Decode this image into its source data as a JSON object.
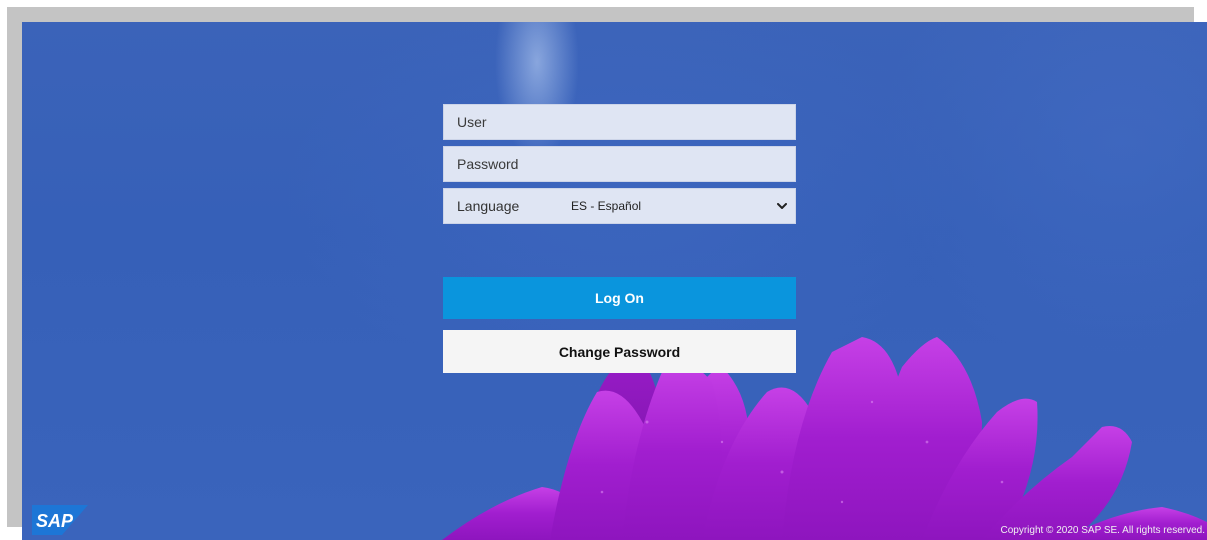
{
  "login": {
    "user_placeholder": "User",
    "password_placeholder": "Password",
    "language_label": "Language",
    "language_value": "ES - Español",
    "logon_label": "Log On",
    "change_password_label": "Change Password"
  },
  "footer": {
    "brand": "SAP",
    "copyright": "Copyright © 2020 SAP SE. All rights reserved."
  },
  "colors": {
    "background_blue": "#3660b8",
    "primary_button": "#0a95dd",
    "secondary_button": "#f5f5f5",
    "input_fill": "#dfe5f3",
    "flower_purple": "#b21fd6"
  },
  "icons": {
    "language_dropdown": "chevron-down-icon"
  }
}
